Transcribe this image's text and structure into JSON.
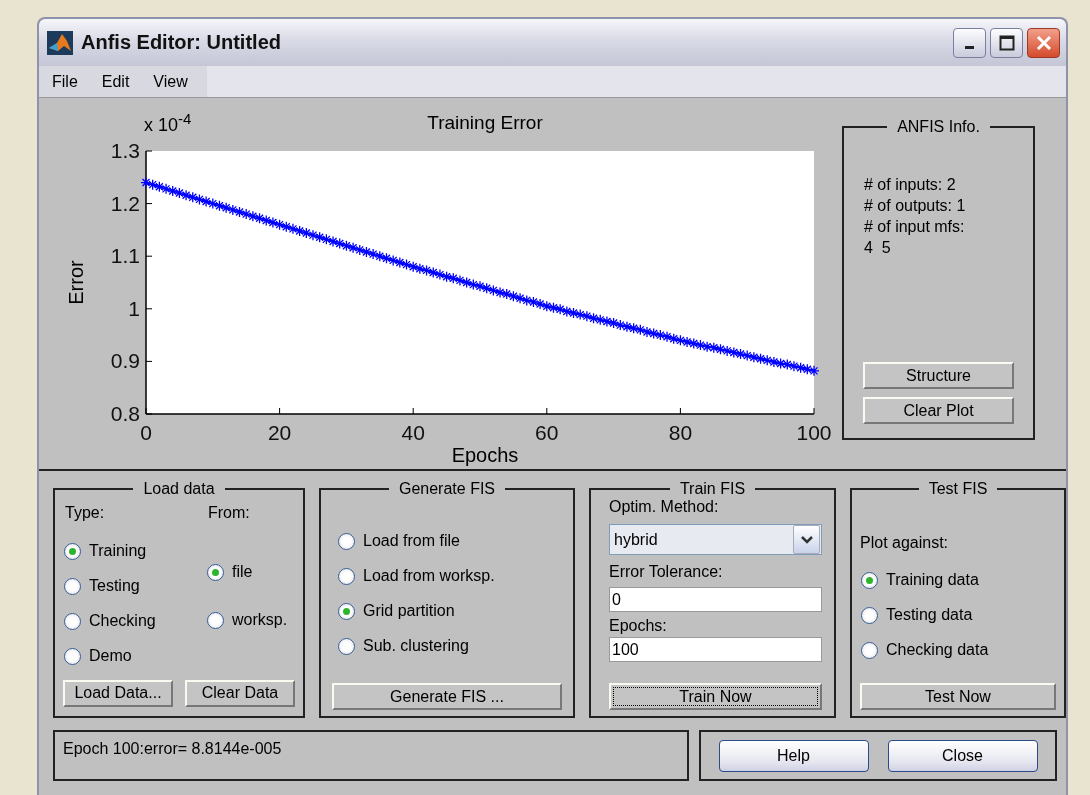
{
  "window": {
    "title": "Anfis Editor: Untitled"
  },
  "menu": [
    "File",
    "Edit",
    "View"
  ],
  "plot": {
    "chart_data": {
      "type": "line",
      "title": "Training Error",
      "xlabel": "Epochs",
      "ylabel": "Error",
      "xlim": [
        0,
        100
      ],
      "ylim": [
        0.8,
        1.3
      ],
      "xticks": [
        0,
        20,
        40,
        60,
        80,
        100
      ],
      "yticks": [
        0.8,
        0.9,
        1,
        1.1,
        1.2,
        1.3
      ],
      "annotations": [
        {
          "text": "x 10$^{-4}$"
        }
      ],
      "x": [
        0,
        1,
        2,
        3,
        4,
        5,
        6,
        7,
        8,
        9,
        10,
        11,
        12,
        13,
        14,
        15,
        16,
        17,
        18,
        19,
        20,
        21,
        22,
        23,
        24,
        25,
        26,
        27,
        28,
        29,
        30,
        31,
        32,
        33,
        34,
        35,
        36,
        37,
        38,
        39,
        40,
        41,
        42,
        43,
        44,
        45,
        46,
        47,
        48,
        49,
        50,
        51,
        52,
        53,
        54,
        55,
        56,
        57,
        58,
        59,
        60,
        61,
        62,
        63,
        64,
        65,
        66,
        67,
        68,
        69,
        70,
        71,
        72,
        73,
        74,
        75,
        76,
        77,
        78,
        79,
        80,
        81,
        82,
        83,
        84,
        85,
        86,
        87,
        88,
        89,
        90,
        91,
        92,
        93,
        94,
        95,
        96,
        97,
        98,
        99,
        100
      ],
      "series": [
        {
          "color": "#0000ff",
          "marker": "cross",
          "values": [
            1.24,
            1.236,
            1.232,
            1.228,
            1.224,
            1.22,
            1.216,
            1.212,
            1.208,
            1.204,
            1.2,
            1.196,
            1.192,
            1.188,
            1.184,
            1.18,
            1.176,
            1.172,
            1.168,
            1.164,
            1.16,
            1.156,
            1.152,
            1.148,
            1.144,
            1.14,
            1.136,
            1.132,
            1.128,
            1.124,
            1.12,
            1.116,
            1.112,
            1.108,
            1.104,
            1.1,
            1.096,
            1.092,
            1.088,
            1.084,
            1.08,
            1.076,
            1.073,
            1.069,
            1.065,
            1.061,
            1.058,
            1.054,
            1.05,
            1.046,
            1.043,
            1.039,
            1.035,
            1.031,
            1.028,
            1.024,
            1.02,
            1.016,
            1.013,
            1.009,
            1.005,
            1.002,
            0.999,
            0.995,
            0.992,
            0.989,
            0.986,
            0.982,
            0.979,
            0.976,
            0.973,
            0.969,
            0.966,
            0.963,
            0.96,
            0.956,
            0.953,
            0.95,
            0.947,
            0.943,
            0.94,
            0.937,
            0.934,
            0.931,
            0.928,
            0.926,
            0.923,
            0.92,
            0.917,
            0.914,
            0.911,
            0.908,
            0.905,
            0.902,
            0.899,
            0.896,
            0.894,
            0.891,
            0.888,
            0.885,
            0.882
          ]
        }
      ]
    }
  },
  "anfis_info": {
    "title": "ANFIS Info.",
    "lines": [
      "# of inputs: 2",
      "# of outputs: 1",
      "# of input mfs:",
      "4  5"
    ],
    "buttons": [
      "Structure",
      "Clear Plot"
    ]
  },
  "load_data": {
    "title": "Load data",
    "type_label": "Type:",
    "from_label": "From:",
    "type_options": [
      {
        "label": "Training",
        "selected": true
      },
      {
        "label": "Testing",
        "selected": false
      },
      {
        "label": "Checking",
        "selected": false
      },
      {
        "label": "Demo",
        "selected": false
      }
    ],
    "from_options": [
      {
        "label": "file",
        "selected": true
      },
      {
        "label": "worksp.",
        "selected": false
      }
    ],
    "buttons": [
      "Load Data...",
      "Clear Data"
    ]
  },
  "generate_fis": {
    "title": "Generate FIS",
    "options": [
      {
        "label": "Load from file",
        "selected": false
      },
      {
        "label": "Load from worksp.",
        "selected": false
      },
      {
        "label": "Grid partition",
        "selected": true
      },
      {
        "label": "Sub. clustering",
        "selected": false
      }
    ],
    "button": "Generate FIS ..."
  },
  "train_fis": {
    "title": "Train FIS",
    "method_label": "Optim. Method:",
    "method": "hybrid",
    "tolerance_label": "Error Tolerance:",
    "tolerance": "0",
    "epochs_label": "Epochs:",
    "epochs": "100",
    "button": {
      "label": "Train Now",
      "focused": true
    }
  },
  "test_fis": {
    "title": "Test FIS",
    "plot_label": "Plot against:",
    "options": [
      {
        "label": "Training data",
        "selected": true
      },
      {
        "label": "Testing data",
        "selected": false
      },
      {
        "label": "Checking data",
        "selected": false
      }
    ],
    "button": "Test Now"
  },
  "status": "Epoch 100:error= 8.8144e-005",
  "footer_buttons": [
    "Help",
    "Close"
  ]
}
